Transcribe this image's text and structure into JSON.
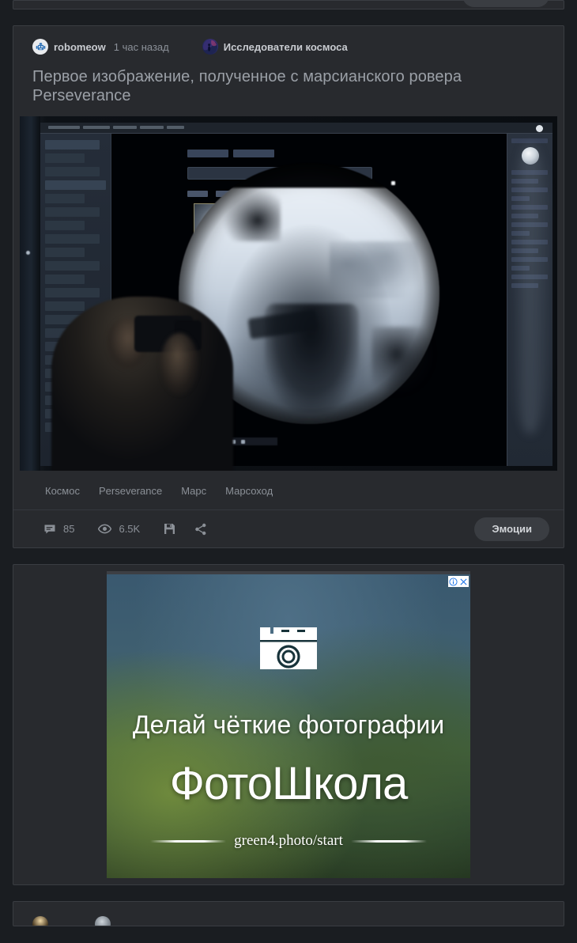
{
  "page": {
    "background_color": "#1a1d21",
    "card_color": "#282a2e",
    "accent_button_color": "#3a3d42"
  },
  "top_partial_post": {
    "emotions_label": ""
  },
  "post": {
    "author": {
      "name": "robomeow",
      "avatar_icon": "robot-avatar-icon"
    },
    "time": "1 час назад",
    "community": {
      "name": "Исследователи космоса",
      "avatar_icon": "space-community-avatar-icon"
    },
    "title": "Первое изображение, полученное с марсианского ровера Perseverance",
    "image_alt": "Фотография экрана с первым снимком марсохода Perseverance",
    "tags": [
      "Космос",
      "Perseverance",
      "Марс",
      "Марсоход"
    ],
    "actions": {
      "comments_icon": "comment-icon",
      "comments_count": "85",
      "views_icon": "eye-icon",
      "views_count": "6.5K",
      "save_icon": "save-floppy-icon",
      "share_icon": "share-icon",
      "emotions_label": "Эмоции"
    }
  },
  "ad": {
    "adchoices_info_icon": "info-icon",
    "adchoices_close_icon": "close-icon",
    "camera_icon": "camera-icon",
    "headline": "Делай чёткие фотографии",
    "brand": "ФотоШкола",
    "url": "green4.photo/start"
  },
  "bottom_partial_post": {
    "author_name": "",
    "time": "",
    "community_name": ""
  }
}
